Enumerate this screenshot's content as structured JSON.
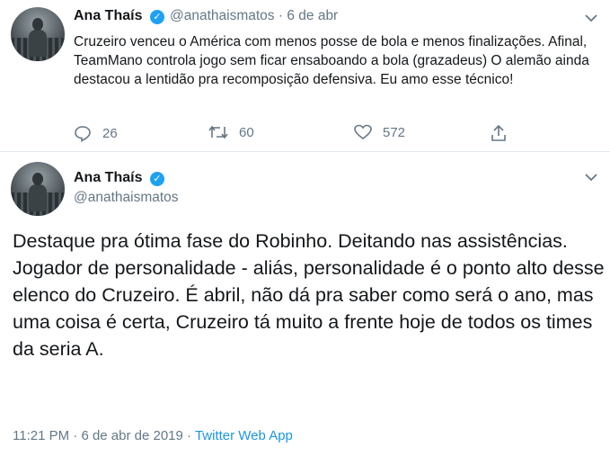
{
  "tweet1": {
    "name": "Ana Thaís",
    "handle": "@anathaismatos",
    "separator": "·",
    "date": "6 de abr",
    "text": "Cruzeiro venceu o América com menos posse de bola e menos finalizações. Afinal, TeamMano controla jogo sem ficar ensaboando a bola (grazadeus) O alemão ainda destacou a lentidão pra recomposição defensiva. Eu amo esse técnico!",
    "replies": "26",
    "retweets": "60",
    "likes": "572"
  },
  "tweet2": {
    "name": "Ana Thaís",
    "handle": "@anathaismatos",
    "text": "Destaque pra ótima fase do Robinho. Deitando nas assistências. Jogador de personalidade - aliás, personalidade é o ponto alto desse elenco do Cruzeiro. É abril, não dá pra saber como será o ano, mas uma coisa é certa, Cruzeiro tá muito a frente hoje de todos os times da seria A.",
    "time": "11:21 PM",
    "meta_separator": "·",
    "date": "6 de abr de 2019",
    "source": "Twitter Web App"
  },
  "icons": {
    "verified": "verified-badge-icon",
    "menu": "chevron-down-icon",
    "reply": "reply-icon",
    "retweet": "retweet-icon",
    "like": "heart-icon",
    "share": "share-icon"
  },
  "colors": {
    "accent": "#1da1f2",
    "link": "#1b95e0",
    "secondary_text": "#657786"
  }
}
